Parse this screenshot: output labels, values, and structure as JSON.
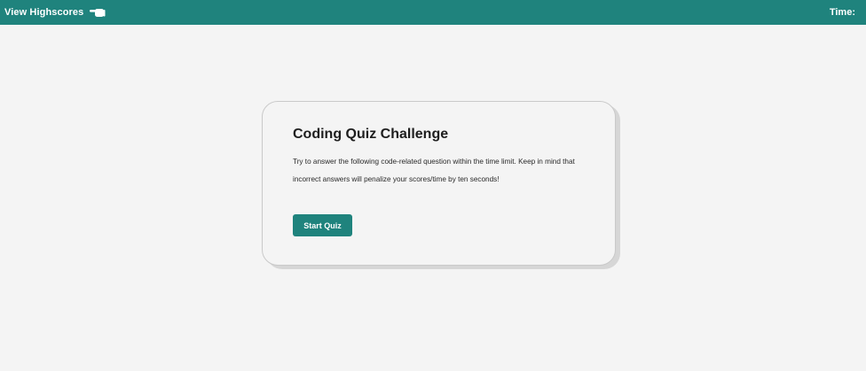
{
  "header": {
    "highscores_label": "View Highscores",
    "highscores_icon": "pointing-hand-icon",
    "time_label": "Time:",
    "time_value": ""
  },
  "quiz": {
    "title": "Coding Quiz Challenge",
    "description": "Try to answer the following code-related question within the time limit. Keep in mind that incorrect answers will penalize your scores/time by ten seconds!",
    "start_label": "Start Quiz"
  },
  "colors": {
    "accent": "#1f837d",
    "background": "#f4f4f4"
  }
}
